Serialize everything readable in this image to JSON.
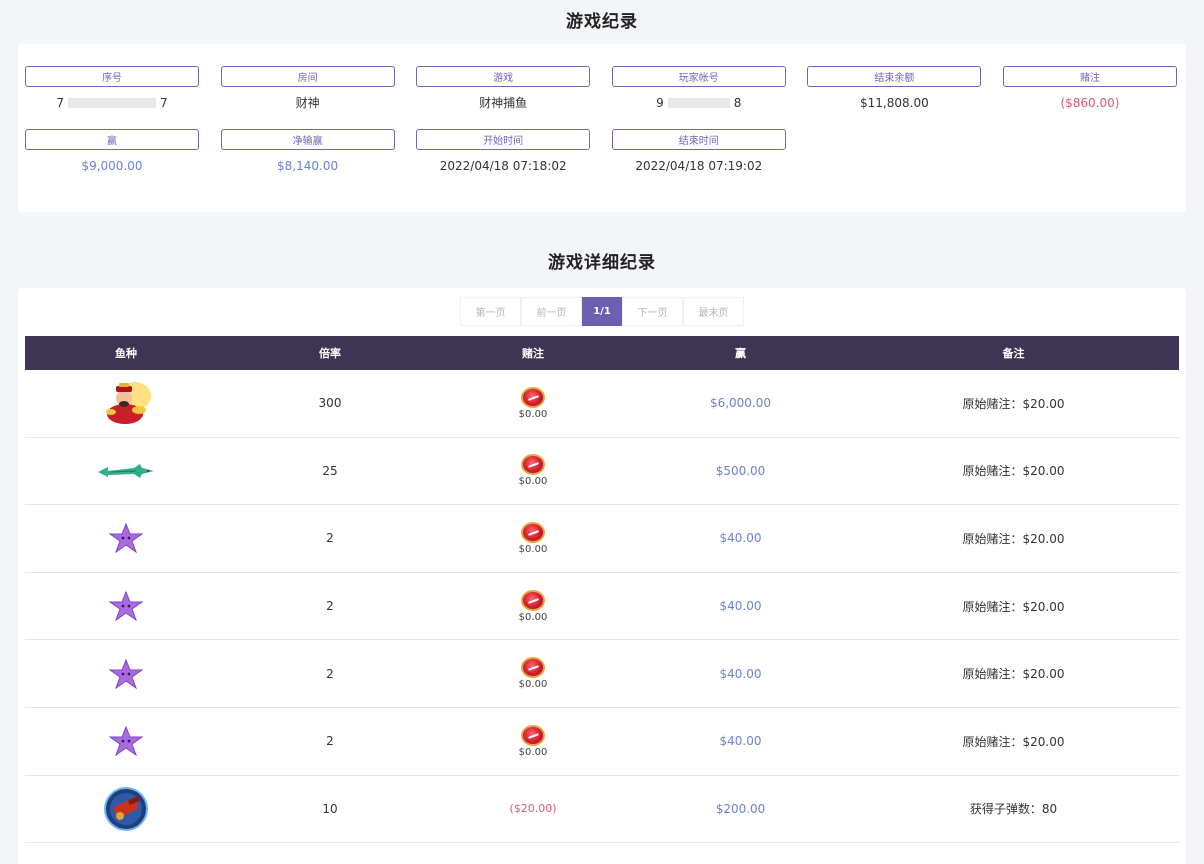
{
  "summary": {
    "title": "游戏纪录",
    "serial": {
      "label": "序号",
      "prefix": "7",
      "suffix": "7"
    },
    "room": {
      "label": "房间",
      "value": "财神"
    },
    "game": {
      "label": "游戏",
      "value": "财神捕鱼"
    },
    "player": {
      "label": "玩家帐号",
      "prefix": "9",
      "suffix": "8"
    },
    "end_balance": {
      "label": "结束余额",
      "value": "$11,808.00"
    },
    "bet": {
      "label": "赌注",
      "value": "($860.00)"
    },
    "win": {
      "label": "赢",
      "value": "$9,000.00"
    },
    "net_win": {
      "label": "净输赢",
      "value": "$8,140.00"
    },
    "start_time": {
      "label": "开始时间",
      "value": "2022/04/18 07:18:02"
    },
    "end_time": {
      "label": "结束时间",
      "value": "2022/04/18 07:19:02"
    }
  },
  "detail": {
    "title": "游戏详细纪录",
    "pager": {
      "first": "第一页",
      "prev": "前一页",
      "current": "1/1",
      "next": "下一页",
      "last": "最末页"
    },
    "columns": {
      "fish": "鱼种",
      "multiplier": "倍率",
      "bet": "赌注",
      "win": "赢",
      "note": "备注"
    },
    "rows": [
      {
        "fish_icon": "god-of-wealth-icon",
        "multiplier": "300",
        "bet": "$0.00",
        "win": "$6,000.00",
        "note": "原始赌注：$20.00"
      },
      {
        "fish_icon": "shark-icon",
        "multiplier": "25",
        "bet": "$0.00",
        "win": "$500.00",
        "note": "原始赌注：$20.00"
      },
      {
        "fish_icon": "starfish-icon",
        "multiplier": "2",
        "bet": "$0.00",
        "win": "$40.00",
        "note": "原始赌注：$20.00"
      },
      {
        "fish_icon": "starfish-icon",
        "multiplier": "2",
        "bet": "$0.00",
        "win": "$40.00",
        "note": "原始赌注：$20.00"
      },
      {
        "fish_icon": "starfish-icon",
        "multiplier": "2",
        "bet": "$0.00",
        "win": "$40.00",
        "note": "原始赌注：$20.00"
      },
      {
        "fish_icon": "starfish-icon",
        "multiplier": "2",
        "bet": "$0.00",
        "win": "$40.00",
        "note": "原始赌注：$20.00"
      },
      {
        "fish_icon": "cannon-icon",
        "multiplier": "10",
        "bet": "($20.00)",
        "win": "$200.00",
        "note": "获得子弹数：80"
      }
    ]
  },
  "colors": {
    "accent": "#6c5fb0",
    "header_bg": "#3e3454",
    "win_blue": "#6b82d1",
    "loss_red": "#e0566f"
  }
}
